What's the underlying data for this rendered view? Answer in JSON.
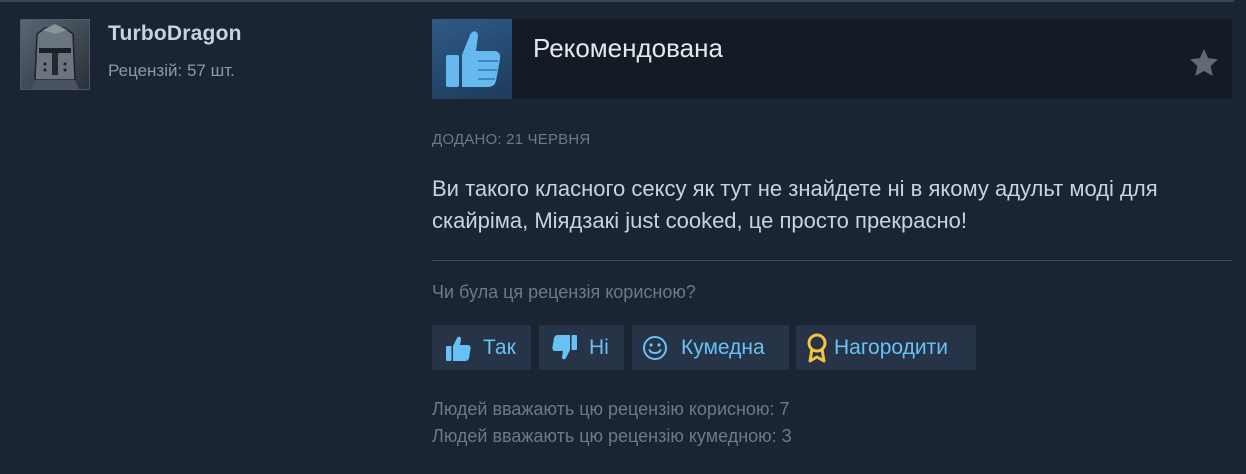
{
  "reviewer": {
    "name": "TurboDragon",
    "review_count": "Рецензій: 57 шт.",
    "avatar_icon": "knight-helmet-icon"
  },
  "review": {
    "verdict": "Рекомендована",
    "verdict_icon": "thumbs-up-icon",
    "favorite_icon": "star-icon",
    "date_posted": "ДОДАНО: 21 ЧЕРВНЯ",
    "text": "Ви такого класного сексу як тут не знайдете ні в якому адульт моді для скайріма, Міядзакі just cooked, це просто прекрасно!"
  },
  "feedback": {
    "question": "Чи була ця рецензія корисною?",
    "buttons": {
      "yes": {
        "label": "Так",
        "icon": "thumbs-up-icon"
      },
      "no": {
        "label": "Ні",
        "icon": "thumbs-down-icon"
      },
      "funny": {
        "label": "Кумедна",
        "icon": "smiley-icon"
      },
      "award": {
        "label": "Нагородити",
        "icon": "award-medal-icon"
      }
    },
    "helpful_count": "Людей вважають цю рецензію корисною: 7",
    "funny_count": "Людей вважають цю рецензію кумедною: 3"
  },
  "colors": {
    "background": "#1b2433",
    "link_blue": "#67c1f5",
    "button_bg": "#273447",
    "muted_text": "#6f7883",
    "award_gold": "#f5c242"
  }
}
